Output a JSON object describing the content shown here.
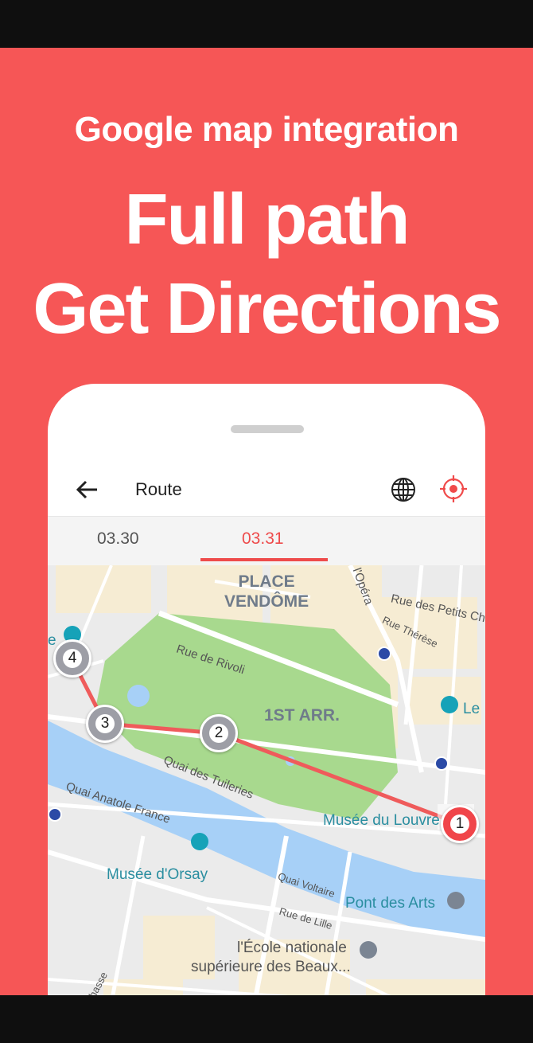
{
  "promo": {
    "subtitle": "Google map integration",
    "headline_line1": "Full path",
    "headline_line2": "Get Directions"
  },
  "appbar": {
    "title": "Route",
    "icons": [
      "back-arrow-icon",
      "globe-icon",
      "locate-target-icon"
    ]
  },
  "tabs": [
    {
      "label": "03.30",
      "selected": false
    },
    {
      "label": "03.31",
      "selected": true
    }
  ],
  "map": {
    "places": {
      "place_vendome_1": "PLACE",
      "place_vendome_2": "VENDÔME",
      "arr": "1ST ARR."
    },
    "streets": {
      "rivoli": "Rue de Rivoli",
      "opera": "l'Opéra",
      "petits_champs": "Rue des Petits Cham",
      "therese": "Rue Thérèse",
      "tuileries": "Quai des Tuileries",
      "anatole": "Quai Anatole France",
      "voltaire": "Quai Voltaire",
      "lille": "Rue de Lille",
      "bellechasse": "e Bellechasse"
    },
    "pois": {
      "louvre": "Musée du Louvre",
      "orsay": "Musée d'Orsay",
      "pont_des_arts": "Pont des Arts",
      "ecole_line1": "l'École nationale",
      "ecole_line2": "supérieure des Beaux...",
      "le": "Le",
      "e": "e"
    },
    "markers": [
      "1",
      "2",
      "3",
      "4"
    ],
    "colors": {
      "route": "#ef5b5b",
      "park": "#a8d98e",
      "water": "#a7d0f7",
      "accent": "#f65656"
    }
  }
}
